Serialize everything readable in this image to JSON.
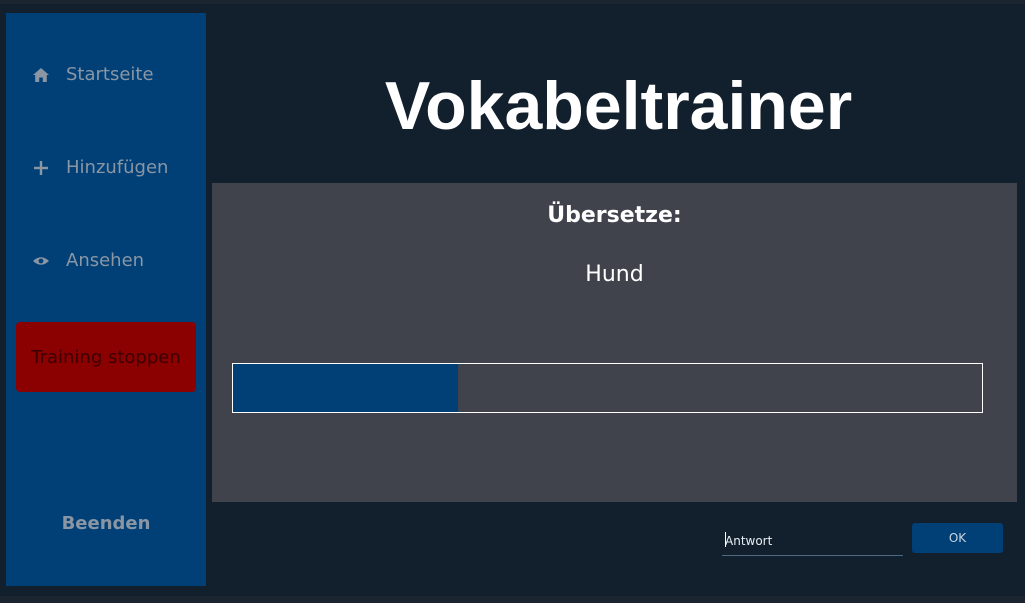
{
  "app": {
    "title": "Vokabeltrainer"
  },
  "sidebar": {
    "items": [
      {
        "label": "Startseite",
        "icon": "home-icon"
      },
      {
        "label": "Hinzufügen",
        "icon": "plus-icon"
      },
      {
        "label": "Ansehen",
        "icon": "eye-icon"
      }
    ],
    "stop_label": "Training stoppen",
    "quit_label": "Beenden"
  },
  "training": {
    "heading": "Übersetze:",
    "word": "Hund",
    "progress_percent": 30
  },
  "answer": {
    "placeholder": "Antwort",
    "value": "",
    "submit_label": "OK"
  },
  "colors": {
    "sidebar": "#004077",
    "stop_button": "#8b0000",
    "card": "#40434c",
    "background": "#121f2c",
    "progress_fill": "#004077"
  }
}
